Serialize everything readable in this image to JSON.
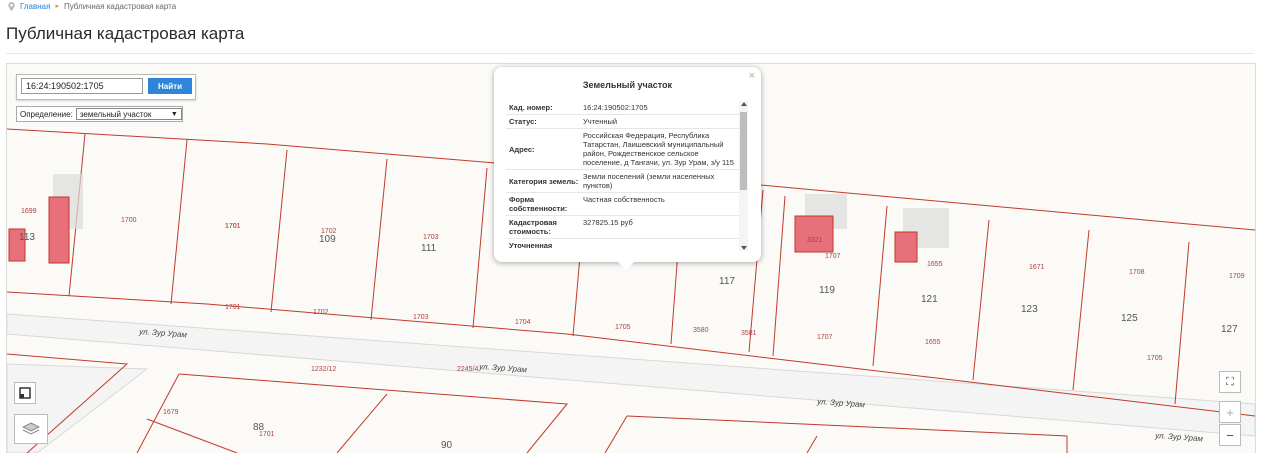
{
  "breadcrumb": {
    "home": "Главная",
    "current": "Публичная кадастровая карта"
  },
  "page": {
    "title": "Публичная кадастровая карта"
  },
  "search": {
    "value": "16:24:190502:1705",
    "button_label": "Найти"
  },
  "definition": {
    "label": "Определение:",
    "selected": "земельный участок"
  },
  "popup": {
    "title": "Земельный участок",
    "close": "×",
    "rows": [
      {
        "key": "Кад. номер:",
        "value": "16:24:190502:1705"
      },
      {
        "key": "Статус:",
        "value": "Учтенный"
      },
      {
        "key": "Адрес:",
        "value": "Российская Федерация, Республика Татарстан, Лаишевский муниципальный район, Рождественское сельское поселение, д Тангачи, ул. Зур Урам, з/у 115"
      },
      {
        "key": "Категория земель:",
        "value": "Земли поселений (земли населенных пунктов)"
      },
      {
        "key": "Форма собственности:",
        "value": "Частная собственность"
      },
      {
        "key": "Кадастровая стоимость:",
        "value": "327825.15 руб"
      },
      {
        "key": "Уточненная",
        "value": ""
      }
    ]
  },
  "map": {
    "parcel_labels": [
      "1699",
      "1700",
      "1701",
      "1702",
      "1703",
      "1704",
      "1705",
      "3580",
      "3581",
      "1707",
      "1655",
      "1671",
      "1708",
      "1709",
      "1232/12",
      "2245/4",
      "1679",
      "1707",
      "1655",
      "1701",
      "1701",
      "1702",
      "1703",
      "1701",
      "1705",
      "3321"
    ],
    "house_numbers": [
      "113",
      "109",
      "111",
      "117",
      "119",
      "121",
      "123",
      "125",
      "127",
      "88",
      "90"
    ],
    "streets": [
      "ул. Зур Урам",
      "ул. Зур Урам",
      "ул. Зур Урам",
      "ул. Зур Урам"
    ],
    "controls": {
      "expand": "⛶",
      "zoom_in": "+",
      "zoom_out": "−"
    }
  },
  "colors": {
    "accent": "#2d86d9",
    "parcel_border": "#c0392b",
    "building": "#e8707a"
  }
}
